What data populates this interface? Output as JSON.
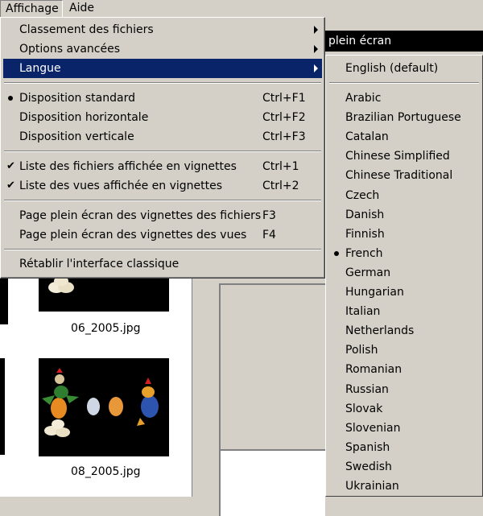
{
  "menubar": {
    "items": [
      "Affichage",
      "Aide"
    ]
  },
  "background": {
    "panel_title": "plein écran",
    "thumbs": [
      {
        "caption": "06_2005.jpg"
      },
      {
        "caption": "08_2005.jpg"
      }
    ]
  },
  "menu": {
    "items": [
      {
        "label": "Classement des fichiers",
        "shortcut": ""
      },
      {
        "label": "Options avancées",
        "shortcut": ""
      },
      {
        "label": "Langue",
        "shortcut": ""
      },
      {
        "label": "Disposition standard",
        "shortcut": "Ctrl+F1"
      },
      {
        "label": "Disposition horizontale",
        "shortcut": "Ctrl+F2"
      },
      {
        "label": "Disposition verticale",
        "shortcut": "Ctrl+F3"
      },
      {
        "label": "Liste des fichiers affichée en vignettes",
        "shortcut": "Ctrl+1"
      },
      {
        "label": "Liste des vues affichée en vignettes",
        "shortcut": "Ctrl+2"
      },
      {
        "label": "Page plein écran des vignettes des fichiers",
        "shortcut": "F3"
      },
      {
        "label": "Page plein écran des vignettes des vues",
        "shortcut": "F4"
      },
      {
        "label": "Rétablir l'interface classique",
        "shortcut": ""
      }
    ]
  },
  "submenu": {
    "default_item": "English (default)",
    "languages": [
      "Arabic",
      "Brazilian Portuguese",
      "Catalan",
      "Chinese Simplified",
      "Chinese Traditional",
      "Czech",
      "Danish",
      "Finnish",
      "French",
      "German",
      "Hungarian",
      "Italian",
      "Netherlands",
      "Polish",
      "Romanian",
      "Russian",
      "Slovak",
      "Slovenian",
      "Spanish",
      "Swedish",
      "Ukrainian"
    ],
    "selected": "French"
  },
  "colors": {
    "highlight": "#0a246a",
    "face": "#d4d0c8"
  }
}
